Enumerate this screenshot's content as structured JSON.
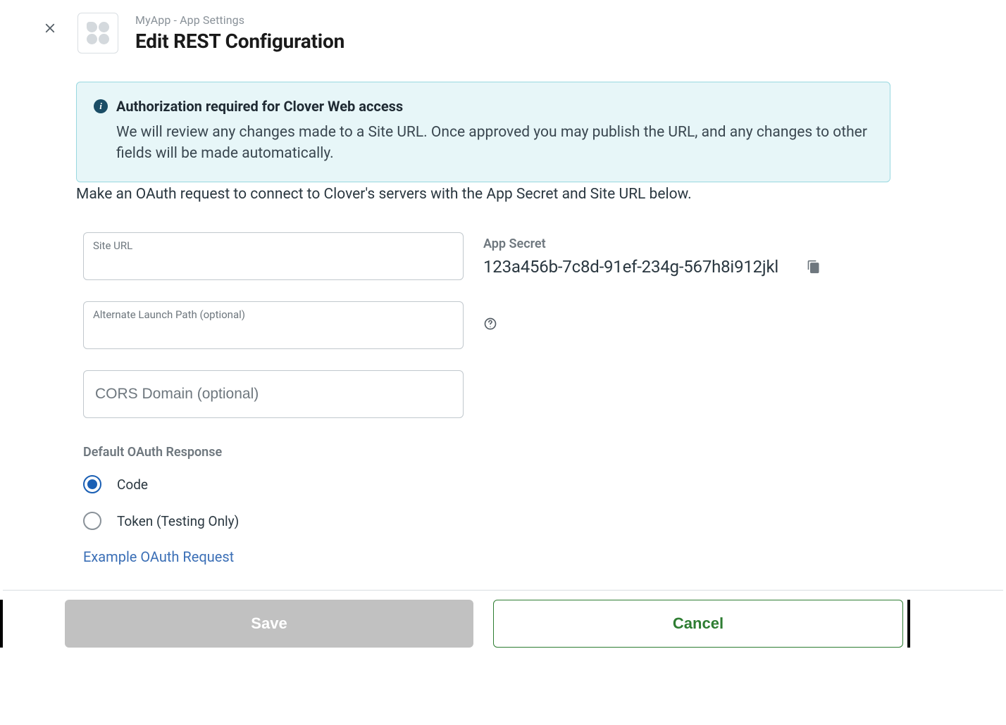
{
  "header": {
    "breadcrumb": "MyApp - App Settings",
    "title": "Edit REST Configuration"
  },
  "alert": {
    "icon_glyph": "i",
    "title": "Authorization required for Clover Web access",
    "body": "We will review any changes made to a Site URL. Once approved you may publish the URL, and any changes to other fields will be made automatically."
  },
  "oauth_description": "Make an OAuth request to connect to Clover's servers with the App Secret and Site URL below.",
  "fields": {
    "site_url": {
      "label": "Site URL",
      "value": ""
    },
    "alt_launch": {
      "label": "Alternate Launch Path (optional)",
      "value": ""
    },
    "cors": {
      "placeholder": "CORS Domain (optional)",
      "value": ""
    }
  },
  "app_secret": {
    "label": "App Secret",
    "value": "123a456b-7c8d-91ef-234g-567h8i912jkl"
  },
  "oauth_response": {
    "heading": "Default OAuth Response",
    "options": [
      {
        "label": "Code",
        "checked": true
      },
      {
        "label": "Token (Testing Only)",
        "checked": false
      }
    ],
    "example_link": "Example OAuth Request"
  },
  "footer": {
    "save": "Save",
    "cancel": "Cancel"
  }
}
